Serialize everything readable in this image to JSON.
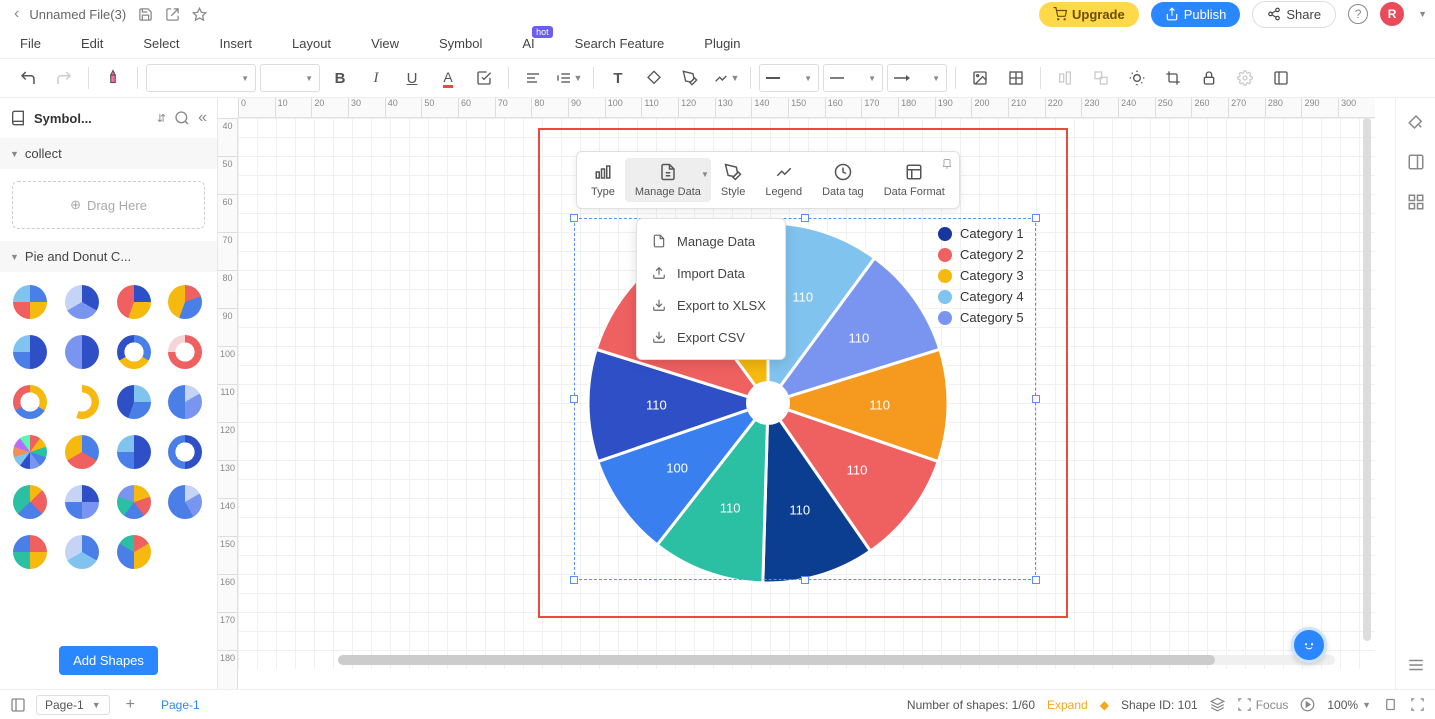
{
  "header": {
    "filename": "Unnamed File(3)",
    "upgrade": "Upgrade",
    "publish": "Publish",
    "share": "Share",
    "avatar_letter": "R"
  },
  "menubar": [
    "File",
    "Edit",
    "Select",
    "Insert",
    "Layout",
    "View",
    "Symbol",
    "AI",
    "Search Feature",
    "Plugin"
  ],
  "menubar_badge": {
    "index": 7,
    "text": "hot"
  },
  "left_panel": {
    "library_name": "Symbol...",
    "sections": {
      "collect": "collect",
      "drag_here": "Drag Here",
      "pie_group": "Pie and Donut C...",
      "add_shapes": "Add Shapes"
    }
  },
  "ruler_h": [
    "0",
    "10",
    "20",
    "30",
    "40",
    "50",
    "60",
    "70",
    "80",
    "90",
    "100",
    "110",
    "120",
    "130",
    "140",
    "150",
    "160",
    "170",
    "180",
    "190",
    "200",
    "210",
    "220",
    "230",
    "240",
    "250",
    "260",
    "270",
    "280",
    "290",
    "300"
  ],
  "ruler_v": [
    "40",
    "50",
    "60",
    "70",
    "80",
    "90",
    "100",
    "110",
    "120",
    "130",
    "140",
    "150",
    "160",
    "170",
    "180"
  ],
  "float_toolbar": {
    "items": [
      {
        "key": "type",
        "label": "Type"
      },
      {
        "key": "manage",
        "label": "Manage Data"
      },
      {
        "key": "style",
        "label": "Style"
      },
      {
        "key": "legend",
        "label": "Legend"
      },
      {
        "key": "datatag",
        "label": "Data tag"
      },
      {
        "key": "dataformat",
        "label": "Data Format"
      }
    ],
    "active": "manage"
  },
  "dropdown": {
    "items": [
      "Manage Data",
      "Import Data",
      "Export to XLSX",
      "Export CSV"
    ]
  },
  "chart_data": {
    "type": "pie",
    "title": "",
    "series": [
      {
        "name": "Category 1",
        "color": "#17369e"
      },
      {
        "name": "Category 2",
        "color": "#ef6060"
      },
      {
        "name": "Category 3",
        "color": "#f5b90f"
      },
      {
        "name": "Category 4",
        "color": "#7fc3ee"
      },
      {
        "name": "Category 5",
        "color": "#7a95ef"
      }
    ],
    "slices": [
      {
        "label": "110",
        "value": 110,
        "color": "#7fc3ee"
      },
      {
        "label": "110",
        "value": 110,
        "color": "#7a95ef"
      },
      {
        "label": "110",
        "value": 110,
        "color": "#f59a1f"
      },
      {
        "label": "110",
        "value": 110,
        "color": "#ef6060"
      },
      {
        "label": "110",
        "value": 110,
        "color": "#0b3d91"
      },
      {
        "label": "110",
        "value": 110,
        "color": "#2bbfa3"
      },
      {
        "label": "100",
        "value": 100,
        "color": "#3a7ff0"
      },
      {
        "label": "110",
        "value": 110,
        "color": "#2f4fc7"
      },
      {
        "label": "110",
        "value": 110,
        "color": "#ef6060"
      },
      {
        "label": "110",
        "value": 110,
        "color": "#f5b90f"
      }
    ]
  },
  "statusbar": {
    "page_selector": "Page-1",
    "page_tab": "Page-1",
    "shapes_count_label": "Number of shapes:",
    "shapes_count": "1/60",
    "expand": "Expand",
    "shape_id_label": "Shape ID:",
    "shape_id": "101",
    "focus": "Focus",
    "zoom": "100%",
    "zoom2": "100%"
  }
}
